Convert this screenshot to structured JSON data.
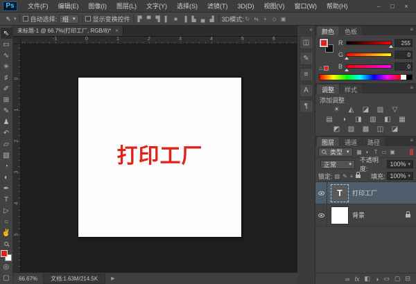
{
  "window": {
    "logo": "Ps",
    "buttons": {
      "minimize": "–",
      "maximize": "□",
      "close": "×"
    }
  },
  "menubar": {
    "items": [
      "文件(F)",
      "编辑(E)",
      "图像(I)",
      "图层(L)",
      "文字(Y)",
      "选择(S)",
      "滤镜(T)",
      "3D(D)",
      "视图(V)",
      "窗口(W)",
      "帮助(H)"
    ]
  },
  "options": {
    "tool_glyph": "⇖",
    "auto_select_label": "自动选择:",
    "auto_select_value": "组",
    "dropdown_arrow": "▾",
    "show_transform_label": "显示变换控件",
    "align_icons": [
      "▛",
      "▀",
      "▜",
      "▌",
      "■",
      "▐",
      "▙",
      "▄",
      "▟"
    ],
    "mode3d_label": "3D模式:",
    "mode3d_icons": [
      "↻",
      "⇆",
      "+",
      "◇",
      "▣"
    ]
  },
  "doc": {
    "tab_title": "未标题-1 @ 66.7%(打印工厂, RGB/8)*",
    "close": "×",
    "canvas_text": "打印工厂",
    "text_color": "#e2231a"
  },
  "ruler": {
    "h": [
      "-1",
      "0",
      "1",
      "2",
      "3",
      "4",
      "5",
      "6"
    ],
    "v": [
      "0",
      "1",
      "2",
      "3",
      "4",
      "5"
    ]
  },
  "toolbar": {
    "tools": [
      {
        "name": "move",
        "glyph": "⇖"
      },
      {
        "name": "marquee",
        "glyph": "▭"
      },
      {
        "name": "lasso",
        "glyph": "∿"
      },
      {
        "name": "quick-selection",
        "glyph": "✳"
      },
      {
        "name": "crop",
        "glyph": "♯"
      },
      {
        "name": "eyedropper",
        "glyph": "✐"
      },
      {
        "name": "healing-brush",
        "glyph": "⊞"
      },
      {
        "name": "brush",
        "glyph": "✎"
      },
      {
        "name": "clone-stamp",
        "glyph": "♟"
      },
      {
        "name": "history-brush",
        "glyph": "↶"
      },
      {
        "name": "eraser",
        "glyph": "▱"
      },
      {
        "name": "gradient",
        "glyph": "▧"
      },
      {
        "name": "blur",
        "glyph": "◔"
      },
      {
        "name": "dodge",
        "glyph": "◐"
      },
      {
        "name": "pen",
        "glyph": "✒"
      },
      {
        "name": "type",
        "glyph": "T"
      },
      {
        "name": "path-selection",
        "glyph": "▷"
      },
      {
        "name": "shape",
        "glyph": "○"
      },
      {
        "name": "hand",
        "glyph": "✌"
      }
    ],
    "fg_color": "#e2231a",
    "bg_color": "#ffffff",
    "quick_mask_glyph": "◎",
    "screen_mode_glyph": "▢"
  },
  "dock": {
    "expand": "«",
    "icons": [
      "◫",
      "✎",
      "≡",
      "A",
      "¶"
    ]
  },
  "color_panel": {
    "tabs": [
      "颜色",
      "色板"
    ],
    "menu": "≡",
    "channels": [
      {
        "label": "R",
        "value": "255"
      },
      {
        "label": "G",
        "value": "0"
      },
      {
        "label": "B",
        "value": "0"
      }
    ]
  },
  "adjust_panel": {
    "tabs": [
      "调整",
      "样式"
    ],
    "menu": "≡",
    "add_label": "添加调整",
    "rows": [
      [
        "☀",
        "◭",
        "◪",
        "▧",
        "▽"
      ],
      [
        "▤",
        "◑",
        "◨",
        "▥",
        "◧",
        "▦"
      ],
      [
        "◩",
        "▨",
        "▩",
        "◫",
        "◪"
      ]
    ]
  },
  "layers_panel": {
    "tabs": [
      "图层",
      "通道",
      "路径"
    ],
    "menu": "≡",
    "filter_label": "类型",
    "filter_arrow": "▾",
    "filter_icons": [
      "▦",
      "◐",
      "T",
      "▭",
      "▣"
    ],
    "blend_mode": "正常",
    "opacity_label": "不透明度:",
    "opacity": "100%",
    "lock_label": "锁定:",
    "lock_icons": [
      "▨",
      "✎",
      "+"
    ],
    "fill_label": "填充:",
    "fill": "100%",
    "layers": [
      {
        "name": "打印工厂",
        "thumb": "T"
      },
      {
        "name": "背景"
      }
    ],
    "bottom_icons": [
      "∞",
      "fx",
      "◧",
      "◑",
      "▭",
      "▢",
      "⊟"
    ]
  },
  "status": {
    "zoom": "66.67%",
    "doc_info": "文档:1.63M/214.5K",
    "arrow": "▶"
  }
}
